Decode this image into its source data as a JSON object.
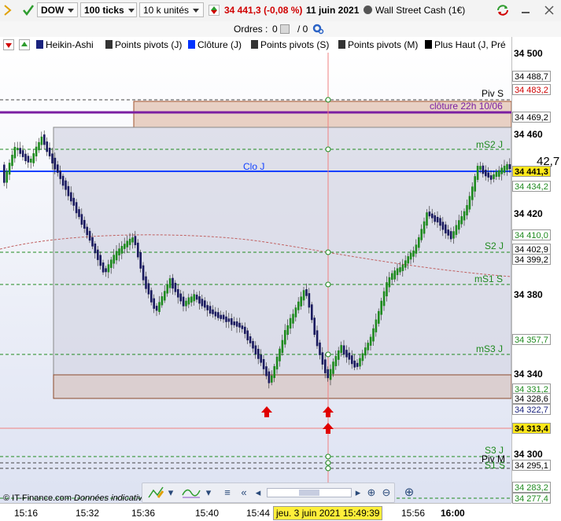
{
  "toolbar": {
    "instrument": "DOW",
    "ticks": "100 ticks",
    "units": "10 k unités",
    "price": "34 441,3",
    "change": "(-0,08 %)",
    "date": "11 juin 2021",
    "product": "Wall Street Cash (1€)"
  },
  "orders": {
    "label": "Ordres :",
    "count": "0",
    "pending": "0"
  },
  "indicators": [
    {
      "label": "Heikin-Ashi",
      "color": "#1a237e"
    },
    {
      "label": "Points pivots (J)",
      "color": "#333333"
    },
    {
      "label": "Clôture (J)",
      "color": "#0033ff"
    },
    {
      "label": "Points pivots (S)",
      "color": "#333333"
    },
    {
      "label": "Points pivots (M)",
      "color": "#333333"
    },
    {
      "label": "Plus Haut (J, Pré",
      "color": "#000000"
    }
  ],
  "chart_labels": {
    "piv_s": "Piv S",
    "cloture": "clôture 22h 10/06",
    "ms2": "mS2 J",
    "clo": "Clo J",
    "s2": "S2 J",
    "ms1": "mS1 S",
    "ms3": "mS3 J",
    "s3": "S3 J",
    "piv_m": "Piv M",
    "s1s": "S1 S"
  },
  "yaxis": {
    "ticks": [
      "34 500",
      "34 460",
      "34 420",
      "34 380",
      "34 340",
      "34 300"
    ],
    "boxes": [
      {
        "v": "34 488,7"
      },
      {
        "v": "34 483,2"
      },
      {
        "v": "34 469,2"
      },
      {
        "v": "34 441,3"
      },
      {
        "v": "34 434,2"
      },
      {
        "v": "34 410,0"
      },
      {
        "v": "34 402,9"
      },
      {
        "v": "34 399,2"
      },
      {
        "v": "34 357,7"
      },
      {
        "v": "34 331,2"
      },
      {
        "v": "34 328,6"
      },
      {
        "v": "34 322,7"
      },
      {
        "v": "34 313,4"
      },
      {
        "v": "34 295,1"
      },
      {
        "v": "34 283,2"
      },
      {
        "v": "34 277,4"
      }
    ],
    "last_price_big": "42,7"
  },
  "xaxis": {
    "ticks": [
      "15:16",
      "15:32",
      "15:36",
      "15:40",
      "15:44",
      "15:56",
      "16:00"
    ],
    "cursor_label": "jeu. 3 juin 2021 15:49:39"
  },
  "footer": {
    "brand": "© IT-Finance.com",
    "note": "Données indicatives"
  },
  "colors": {
    "up": "#1f8a1f",
    "down": "#1a1a5e",
    "accent": "#7b1fa2",
    "price_line": "#1040ff"
  }
}
